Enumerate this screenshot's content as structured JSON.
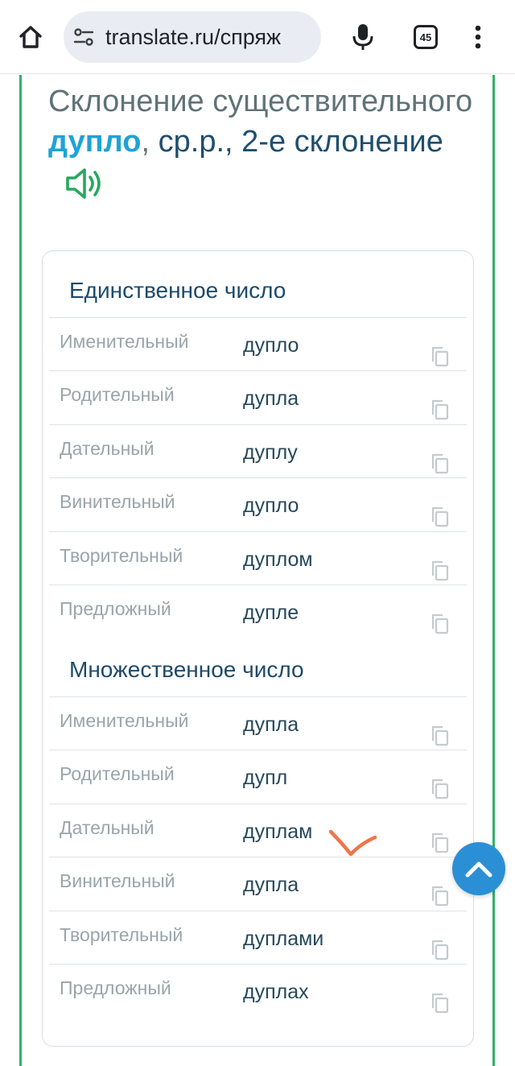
{
  "browser": {
    "url": "translate.ru/спряж",
    "tab_count": "45"
  },
  "page": {
    "title_prefix": "Склонение существительного ",
    "title_word": "дупло",
    "title_suffix": ",",
    "title_info": "ср.р., 2-е склонение"
  },
  "singular": {
    "title": "Единственное число",
    "rows": [
      {
        "case": "Именительный",
        "form": "дупло"
      },
      {
        "case": "Родительный",
        "form": "дупла"
      },
      {
        "case": "Дательный",
        "form": "дуплу"
      },
      {
        "case": "Винительный",
        "form": "дупло"
      },
      {
        "case": "Творительный",
        "form": "дуплом"
      },
      {
        "case": "Предложный",
        "form": "дупле"
      }
    ]
  },
  "plural": {
    "title": "Множественное число",
    "rows": [
      {
        "case": "Именительный",
        "form": "дупла"
      },
      {
        "case": "Родительный",
        "form": "дупл"
      },
      {
        "case": "Дательный",
        "form": "дуплам"
      },
      {
        "case": "Винительный",
        "form": "дупла"
      },
      {
        "case": "Творительный",
        "form": "дуплами"
      },
      {
        "case": "Предложный",
        "form": "дуплах"
      }
    ]
  },
  "icons": {
    "home": "home-icon",
    "tune": "site-settings-icon",
    "mic": "microphone-icon",
    "menu": "more-vert-icon",
    "speaker": "speaker-icon",
    "copy": "copy-icon",
    "scroll_top": "chevron-up-icon"
  },
  "colors": {
    "accent_green": "#2fb36a",
    "word_blue": "#1ea3d6",
    "heading_navy": "#1d4a6a",
    "scroll_button": "#2b8fd6",
    "handwritten_mark": "#f0744a"
  }
}
